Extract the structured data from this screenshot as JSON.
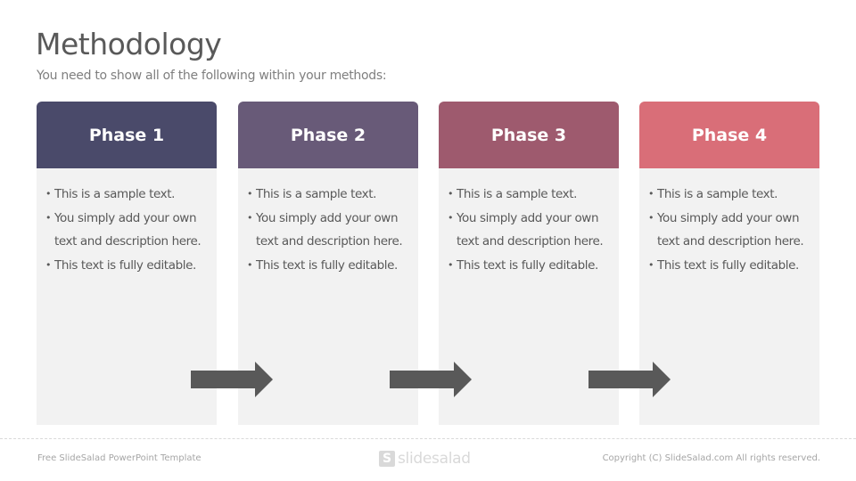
{
  "slide": {
    "title": "Methodology",
    "subtitle": "You need to show all of the following within your methods:"
  },
  "phases": [
    {
      "label": "Phase 1",
      "color": "#4a4a6a",
      "bullets": [
        "This is a sample text.",
        " You simply add your own text and description here.",
        "This text is fully editable."
      ]
    },
    {
      "label": "Phase 2",
      "color": "#685a78",
      "bullets": [
        "This is a sample text.",
        " You simply add your own text and description here.",
        "This text is fully editable."
      ]
    },
    {
      "label": "Phase 3",
      "color": "#9e5a6e",
      "bullets": [
        "This is a sample text.",
        " You simply add your own text and description here.",
        "This text is fully editable."
      ]
    },
    {
      "label": "Phase 4",
      "color": "#d96e78",
      "bullets": [
        "This is a sample text.",
        " You simply add your own text and description here.",
        "This text is fully editable."
      ]
    }
  ],
  "arrow_color": "#595959",
  "footer": {
    "left": "Free SlideSalad PowerPoint Template",
    "logo_mark": "S",
    "logo_text": "slidesalad",
    "right": "Copyright (C) SlideSalad.com  All rights reserved."
  }
}
